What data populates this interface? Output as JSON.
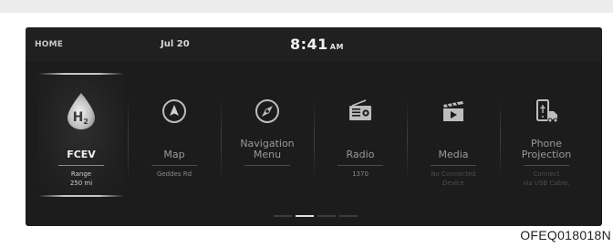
{
  "status_bar": {
    "home_label": "HOME",
    "date": "Jul 20",
    "time": "8:41",
    "ampm": "AM"
  },
  "tiles": [
    {
      "key": "fcev",
      "label_lines": [
        "FCEV"
      ],
      "icon": "hydrogen-drop-icon",
      "icon_text": "H",
      "icon_sub": "2",
      "sub_lines": [
        "Range",
        "250 mi"
      ],
      "selected": true
    },
    {
      "key": "map",
      "label_lines": [
        "Map"
      ],
      "icon": "navigation-arrow-icon",
      "sub_lines": [
        "Geddes Rd"
      ]
    },
    {
      "key": "navigation-menu",
      "label_lines": [
        "Navigation",
        "Menu"
      ],
      "icon": "compass-icon",
      "sub_lines": []
    },
    {
      "key": "radio",
      "label_lines": [
        "Radio"
      ],
      "icon": "radio-icon",
      "sub_lines": [
        "1370"
      ]
    },
    {
      "key": "media",
      "label_lines": [
        "Media"
      ],
      "icon": "clapperboard-icon",
      "sub_lines": [
        "No Connected",
        "Device"
      ],
      "sub_dim": true
    },
    {
      "key": "phone-projection",
      "label_lines": [
        "Phone",
        "Projection"
      ],
      "icon": "phone-projection-icon",
      "sub_lines": [
        "Connect",
        "via USB Cable."
      ],
      "sub_dim": true
    }
  ],
  "pager": {
    "pages": 4,
    "active": 2
  },
  "caption": "OFEQ018018N",
  "colors": {
    "screen_bg": "#1c1c1c",
    "selected_text": "#f0f0f0",
    "normal_text": "#9a9a9a"
  }
}
